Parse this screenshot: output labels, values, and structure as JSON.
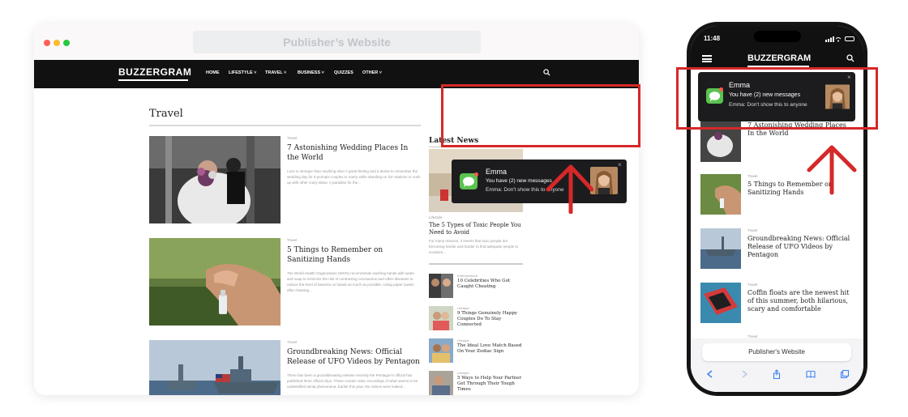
{
  "desktop": {
    "url_bar": "Publisher’s Website",
    "site": {
      "logo": "BUZZERGRAM",
      "nav": [
        "HOME",
        "LIFESTYLE ˅",
        "TRAVEL ˅",
        "BUSINESS ˅",
        "QUIZZES",
        "OTHER ˅"
      ],
      "section_title": "Travel",
      "articles": [
        {
          "category": "Travel",
          "title": "7 Astonishing Wedding Places In the World",
          "excerpt": "Love is stronger than anything else! A great feeling and a desire to remember the wedding day for it prompts couples to marry while standing on lion stations or curls up with other crazy ideas. A paradise for the..."
        },
        {
          "category": "Travel",
          "title": "5 Things to Remember on Sanitizing Hands",
          "excerpt": "The World Health Organization (WHO) recommends washing hands with water and soap to minimize the risk of contracting coronavirus and other diseases to reduce the level of bacteria on hands as much as possible. Using paper towels after cleaning..."
        },
        {
          "category": "Travel",
          "title": "Groundbreaking News: Official Release of UFO Videos by Pentagon",
          "excerpt": "There has been a groundbreaking release recently the Pentagon's official has published three official clips. These contain video recordings of what seems to be unidentified aerial phenomena. Earlier this year, the videos were leaked..."
        }
      ],
      "latest_news": {
        "title": "Latest News",
        "featured": {
          "category": "Lifestyle",
          "title": "The 5 Types of Toxic People You Need to Avoid",
          "excerpt": "For many reasons, it seems that toxic people are becoming harder and harder to find adequate people to socialize..."
        },
        "items": [
          {
            "category": "Entertainment",
            "title": "10 Celebrities Who Got Caught Cheating"
          },
          {
            "category": "Lifestyle",
            "title": "9 Things Genuinely Happy Couples Do To Stay Connected"
          },
          {
            "category": "Lifestyle",
            "title": "The Ideal Love Match Based On Your Zodiac Sign"
          },
          {
            "category": "Lifestyle",
            "title": "5 Ways to Help Your Partner Get Through Their Tough Times"
          }
        ]
      }
    },
    "notification": {
      "name": "Emma",
      "message": "You have (2) new messages",
      "subtext": "Emma: Don't show this to anyone",
      "close": "×"
    }
  },
  "mobile": {
    "time": "11:48",
    "logo": "BUZZERGRAM",
    "notification": {
      "name": "Emma",
      "message": "You have (2) new messages",
      "subtext": "Emma: Don't show this to anyone",
      "close": "×"
    },
    "articles": [
      {
        "category": "",
        "title": "7 Astonishing Wedding Places In the World"
      },
      {
        "category": "Travel",
        "title": "5 Things to Remember on Sanitizing Hands"
      },
      {
        "category": "Travel",
        "title": "Groundbreaking News: Official Release of UFO Videos by Pentagon"
      },
      {
        "category": "Travel",
        "title": "Coffin floats are the newest hit of this summer, both hilarious, scary and comfortable"
      },
      {
        "category": "Travel",
        "title": ""
      }
    ],
    "url_bar": "Publisher's Website"
  },
  "colors": {
    "highlight": "#d62828",
    "notification_bg": "#1c1c1e",
    "messages_green": "#5ac34f",
    "navbar": "#111111"
  }
}
